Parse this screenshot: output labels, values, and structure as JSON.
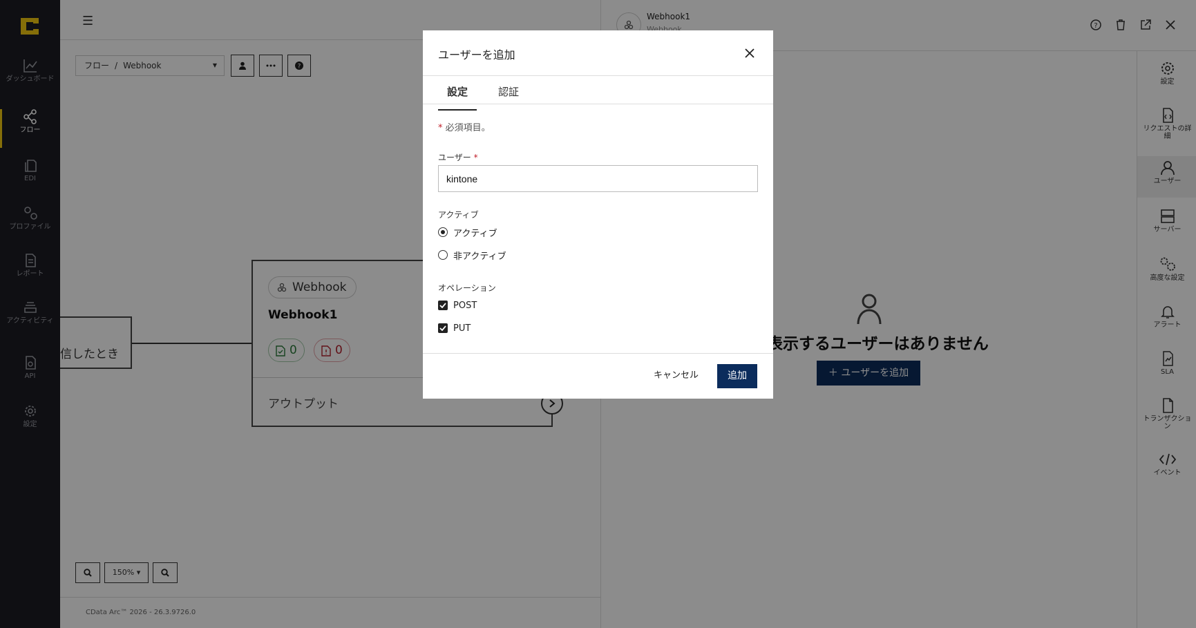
{
  "nav": {
    "items": [
      {
        "label": "ダッシュボード",
        "icon": "chart-line-icon"
      },
      {
        "label": "フロー",
        "icon": "share-nodes-icon"
      },
      {
        "label": "EDI",
        "icon": "documents-icon"
      },
      {
        "label": "プロファイル",
        "icon": "gears-icon"
      },
      {
        "label": "レポート",
        "icon": "report-icon"
      },
      {
        "label": "アクティビティ",
        "icon": "layers-icon"
      },
      {
        "label": "API",
        "icon": "api-file-icon"
      },
      {
        "label": "設定",
        "icon": "gear-icon"
      }
    ]
  },
  "canvas": {
    "breadcrumb_root": "フロー",
    "breadcrumb_sep": "/",
    "breadcrumb_current": "Webhook",
    "left_node_text": "信したとき",
    "node_chip": "Webhook",
    "node_title": "Webhook1",
    "success_count": "0",
    "error_count": "0",
    "node_output": "アウトプット",
    "zoom_level": "150%",
    "footer": "CData Arc™ 2026 - 26.3.9726.0"
  },
  "panel": {
    "title": "Webhook1",
    "subtitle": "Webhook",
    "empty_text": "表示するユーザーはありません",
    "add_button": "ユーザーを追加",
    "sidebar": [
      {
        "label": "設定",
        "icon": "gear-icon"
      },
      {
        "label": "リクエストの詳細",
        "icon": "file-code-icon"
      },
      {
        "label": "ユーザー",
        "icon": "user-icon"
      },
      {
        "label": "サーバー",
        "icon": "server-icon"
      },
      {
        "label": "高度な設定",
        "icon": "advanced-gears-icon"
      },
      {
        "label": "アラート",
        "icon": "bell-icon"
      },
      {
        "label": "SLA",
        "icon": "sla-file-icon"
      },
      {
        "label": "トランザクション",
        "icon": "file-icon"
      },
      {
        "label": "イベント",
        "icon": "code-icon"
      }
    ]
  },
  "modal": {
    "title": "ユーザーを追加",
    "tabs": [
      "設定",
      "認証"
    ],
    "required_note": "必須項目。",
    "user_label": "ユーザー",
    "user_value": "kintone",
    "active_label": "アクティブ",
    "active_options": [
      "アクティブ",
      "非アクティブ"
    ],
    "operations_label": "オペレーション",
    "operations": [
      "POST",
      "PUT"
    ],
    "cancel": "キャンセル",
    "submit": "追加"
  }
}
